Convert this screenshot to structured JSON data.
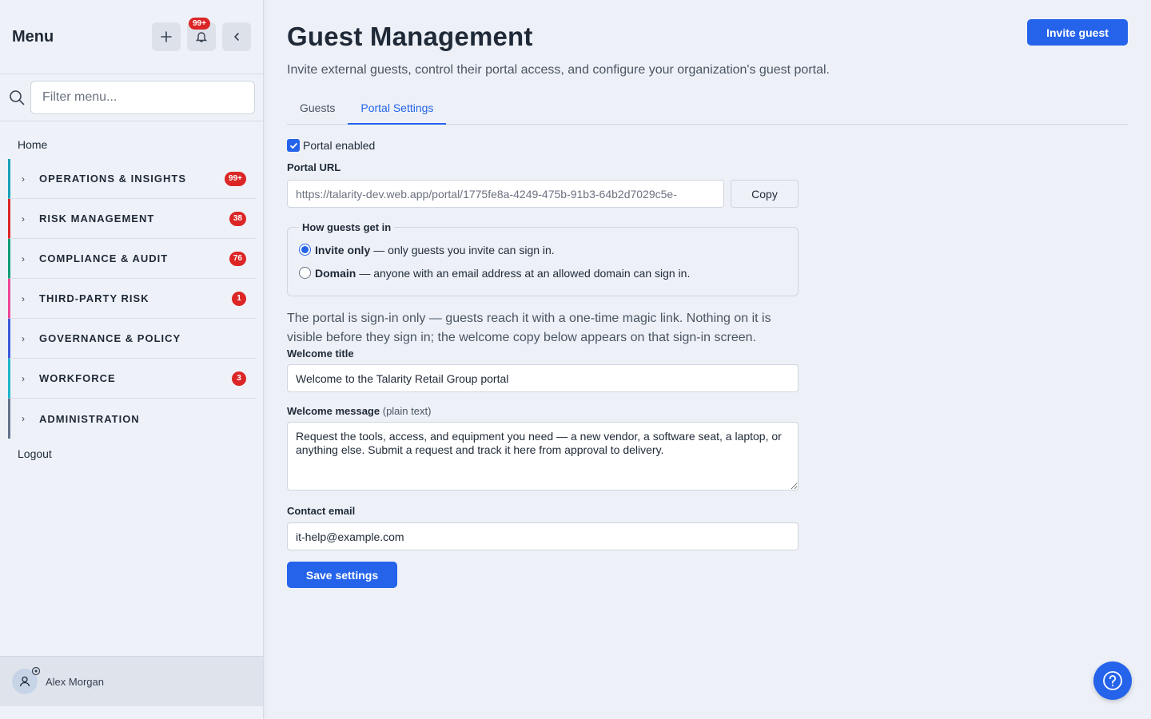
{
  "sidebar": {
    "title": "Menu",
    "notifications_badge": "99+",
    "search_placeholder": "Filter menu...",
    "home": "Home",
    "items": [
      {
        "label": "OPERATIONS & INSIGHTS",
        "count": "99+",
        "color": "#17a2b8"
      },
      {
        "label": "RISK MANAGEMENT",
        "count": "38",
        "color": "#dc2626"
      },
      {
        "label": "COMPLIANCE & AUDIT",
        "count": "76",
        "color": "#0f9d76"
      },
      {
        "label": "THIRD-PARTY RISK",
        "count": "1",
        "color": "#ec4899"
      },
      {
        "label": "GOVERNANCE & POLICY",
        "count": "",
        "color": "#3b5bdb"
      },
      {
        "label": "WORKFORCE",
        "count": "3",
        "color": "#1fb5c9"
      },
      {
        "label": "ADMINISTRATION",
        "count": "",
        "color": "#64748b"
      }
    ],
    "logout": "Logout",
    "user_name": "Alex Morgan"
  },
  "header": {
    "title": "Guest Management",
    "subtitle": "Invite external guests, control their portal access, and configure your organization's guest portal.",
    "invite_button": "Invite guest"
  },
  "tabs": [
    {
      "label": "Guests",
      "active": false
    },
    {
      "label": "Portal Settings",
      "active": true
    }
  ],
  "form": {
    "portal_enabled_label": "Portal enabled",
    "portal_enabled": true,
    "portal_url_label": "Portal URL",
    "portal_url": "https://talarity-dev.web.app/portal/1775fe8a-4249-475b-91b3-64b2d7029c5e-",
    "copy_button": "Copy",
    "access_legend": "How guests get in",
    "invite_only_label": "Invite only",
    "invite_only_desc": "— only guests you invite can sign in.",
    "domain_label": "Domain",
    "domain_desc": "— anyone with an email address at an allowed domain can sign in.",
    "selected_access": "Invite only",
    "info_text": "The portal is sign-in only — guests reach it with a one-time magic link. Nothing on it is visible before they sign in; the welcome copy below appears on that sign-in screen.",
    "welcome_title_label": "Welcome title",
    "welcome_title": "Welcome to the Talarity Retail Group portal",
    "welcome_message_label": "Welcome message",
    "welcome_message_note": "(plain text)",
    "welcome_message": "Request the tools, access, and equipment you need — a new vendor, a software seat, a laptop, or anything else. Submit a request and track it here from approval to delivery.",
    "contact_email_label": "Contact email",
    "contact_email": "it-help@example.com",
    "save_button": "Save settings"
  },
  "colors": {
    "accent": "#2563eb",
    "badge": "#dc2626"
  },
  "icons": [
    "plus-icon",
    "bell-icon",
    "chevron-left-icon",
    "search-icon",
    "chevron-right-icon",
    "user-icon",
    "gear-icon",
    "help-icon",
    "check-icon"
  ]
}
